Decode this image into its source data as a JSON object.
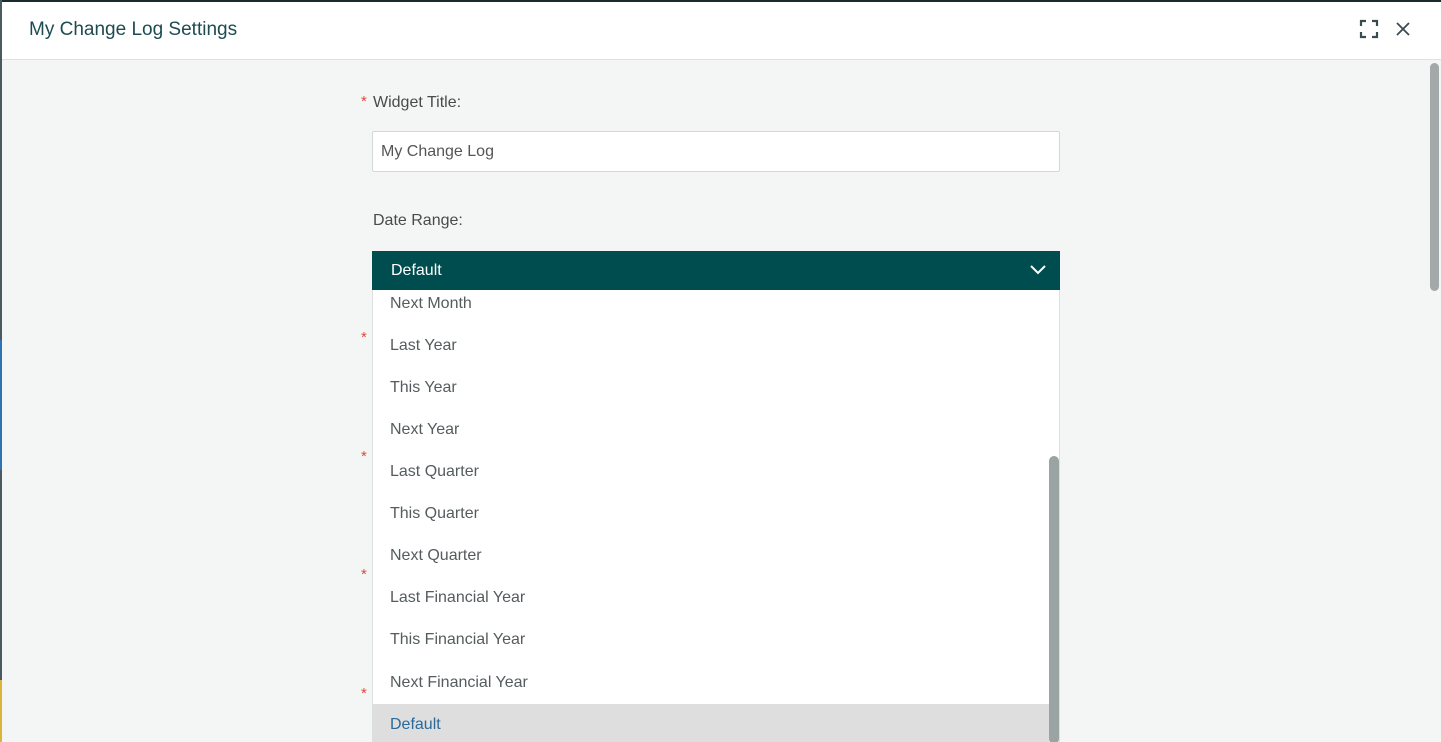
{
  "dialog": {
    "title": "My Change Log Settings"
  },
  "icons": {
    "maximize": "maximize-icon",
    "close": "close-icon",
    "chevron": "chevron-down-icon"
  },
  "form": {
    "required_marker": "*",
    "widget_title_label": "Widget Title:",
    "widget_title_value": "My Change Log",
    "date_range_label": "Date Range:",
    "date_range_selected": "Default"
  },
  "dropdown": {
    "options": [
      "Next Month",
      "Last Year",
      "This Year",
      "Next Year",
      "Last Quarter",
      "This Quarter",
      "Next Quarter",
      "Last Financial Year",
      "This Financial Year",
      "Next Financial Year",
      "Default"
    ],
    "selected": "Default"
  },
  "colors": {
    "accent": "#004d4f",
    "title": "#1e4b52",
    "required": "#e0483b",
    "selected_option_text": "#2a6a9a",
    "selected_option_bg": "#dedede"
  }
}
